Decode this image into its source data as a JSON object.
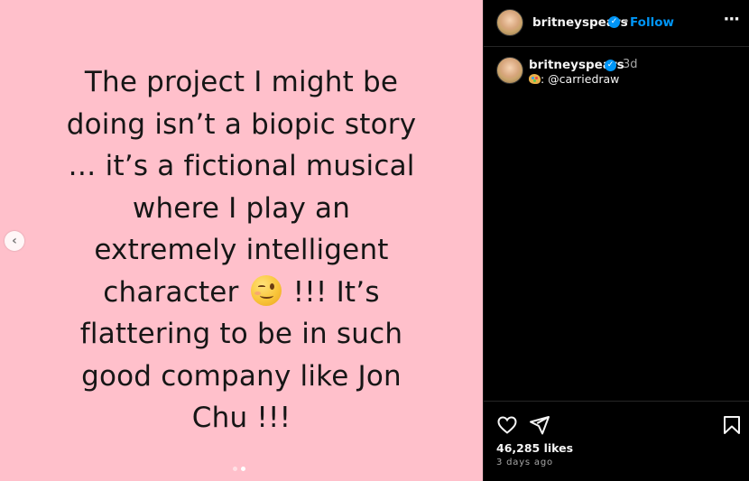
{
  "post": {
    "text_lines": [
      "The project I might be",
      "doing isn’t a biopic story",
      "… it’s a fictional musical",
      "where I play an",
      "extremely intelligent",
      "character",
      "!!! It’s",
      "flattering to be in such",
      "good company like Jon",
      "Chu !!!"
    ],
    "emoji": "winking-face",
    "background": "#ffc0cb",
    "slide_count": 2,
    "active_slide": 2
  },
  "header": {
    "username": "britneyspears",
    "separator": "•",
    "follow_label": "Follow",
    "more_label": "···"
  },
  "caption": {
    "username": "britneyspears",
    "time": "3d",
    "credit_text": ": @carriedraw"
  },
  "footer": {
    "likes": "46,285 likes",
    "posted": "3 days ago"
  },
  "nav": {
    "prev_label": "‹"
  },
  "colors": {
    "accent": "#0095f6",
    "panel": "#000000",
    "muted": "#a8a8a8"
  }
}
